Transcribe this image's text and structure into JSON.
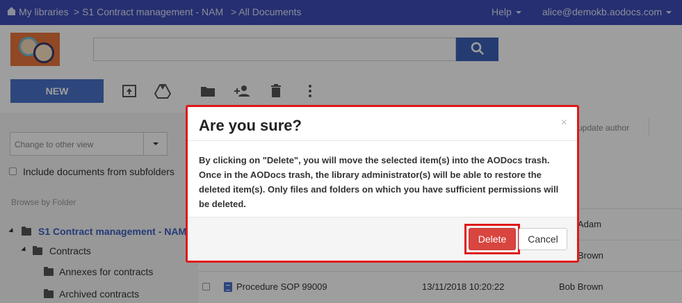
{
  "topbar": {
    "my_libraries": "My libraries",
    "library": "> S1 Contract management - NAM",
    "view": "> All Documents",
    "help": "Help",
    "user": "alice@demokb.aodocs.com"
  },
  "header": {
    "search_value": ""
  },
  "toolbar": {
    "new_label": "NEW",
    "icons": [
      "upload-icon",
      "google-drive-icon",
      "folder-icon",
      "add-user-icon",
      "trash-icon",
      "more-vert-icon"
    ]
  },
  "sidebar": {
    "view_select_placeholder": "Change to other view",
    "include_subfolders": "Include documents from subfolders",
    "browse_label": "Browse by Folder",
    "tree": [
      {
        "label": "S1 Contract management - NAM"
      },
      {
        "label": "Contracts"
      },
      {
        "label": "Annexes for contracts"
      },
      {
        "label": "Archived contracts"
      }
    ]
  },
  "table": {
    "col_update_author": "update author",
    "rows": [
      {
        "name": "",
        "date": "",
        "author": "Adam"
      },
      {
        "name": "",
        "date": "",
        "author": "Brown"
      },
      {
        "name": "Procedure SOP 99009",
        "date": "13/11/2018 10:20:22",
        "author": "Bob Brown"
      }
    ]
  },
  "dialog": {
    "title": "Are you sure?",
    "close": "×",
    "body": "By clicking on \"Delete\", you will move the selected item(s) into the AODocs trash. Once in the AODocs trash, the library administrator(s) will be able to restore the deleted item(s). Only files and folders on which you have sufficient permissions will be deleted.",
    "delete_label": "Delete",
    "cancel_label": "Cancel"
  },
  "colors": {
    "topbar": "#3d4db7",
    "primary": "#4a71c8",
    "danger": "#d9453f",
    "highlight": "#e01818"
  }
}
